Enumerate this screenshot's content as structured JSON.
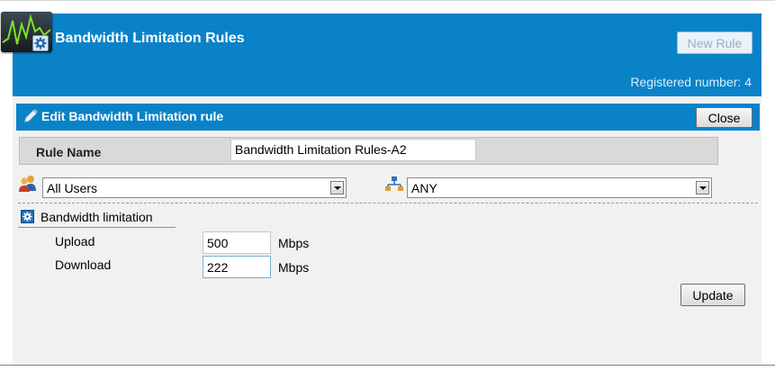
{
  "header": {
    "title": "Bandwidth Limitation Rules",
    "new_rule_label": "New Rule",
    "registered_text": "Registered number: 4",
    "logo_icon": "activity-monitor-logo",
    "title_icon": "gear-icon"
  },
  "editor": {
    "title": "Edit Bandwidth Limitation rule",
    "close_label": "Close",
    "rule_name_label": "Rule Name",
    "rule_name_value": "Bandwidth Limitation Rules-A2",
    "user_select": {
      "icon": "users-icon",
      "value": "All Users"
    },
    "network_select": {
      "icon": "network-icon",
      "value": "ANY"
    },
    "bandwidth": {
      "title": "Bandwidth limitation",
      "upload_label": "Upload",
      "upload_value": "500",
      "upload_unit": "Mbps",
      "download_label": "Download",
      "download_value": "222",
      "download_unit": "Mbps"
    },
    "update_label": "Update"
  },
  "colors": {
    "header_blue": "#0a82c8",
    "panel_gray": "#f1f1f1"
  }
}
